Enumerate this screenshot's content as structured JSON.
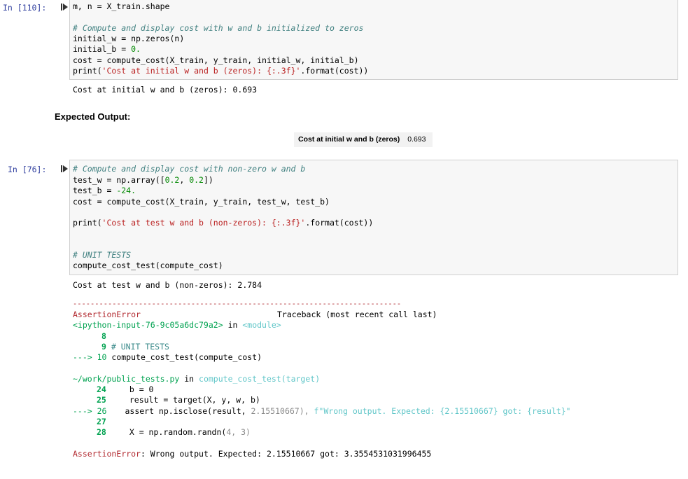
{
  "cell110": {
    "prompt": "In [110]:",
    "code": {
      "line0": "m, n = X_train.shape",
      "comment": "# Compute and display cost with w and b initialized to zeros",
      "l_iw": "initial_w = np.zeros(n)",
      "l_ib_a": "initial_b = ",
      "l_ib_b": "0.",
      "l_cost": "cost = compute_cost(X_train, y_train, initial_w, initial_b)",
      "l_print_a": "print(",
      "l_print_s": "'Cost at initial w and b (zeros): {:.3f}'",
      "l_print_b": ".format(cost))"
    },
    "output": "Cost at initial w and b (zeros): 0.693"
  },
  "expected": {
    "heading": "Expected Output:",
    "table_label": "Cost at initial w and b (zeros)",
    "table_value": "0.693"
  },
  "cell76": {
    "prompt": "In [76]:",
    "code": {
      "comment1": "# Compute and display cost with non-zero w and b",
      "l_tw": "test_w = np.array([0.2, 0.2])",
      "l_tb_a": "test_b = ",
      "l_tb_b": "-24.",
      "l_cost": "cost = compute_cost(X_train, y_train, test_w, test_b)",
      "l_print_a": "print(",
      "l_print_s": "'Cost at test w and b (non-zeros): {:.3f}'",
      "l_print_b": ".format(cost))",
      "comment2": "# UNIT TESTS",
      "l_test": "compute_cost_test(compute_cost)"
    },
    "output": "Cost at test w and b (non-zeros): 2.784",
    "traceback": {
      "dashes": "---------------------------------------------------------------------------",
      "err_name": "AssertionError",
      "tb_label": "Traceback (most recent call last)",
      "input_ref": "<ipython-input-76-9c05a6dc79a2>",
      "in_word": " in ",
      "module": "<module>",
      "ln8": "8",
      "ln9": "9",
      "ln9_code": "# UNIT TESTS",
      "arrow10": "---> 10",
      "ln10_code": "compute_cost_test(compute_cost)",
      "file": "~/work/public_tests.py",
      "in_word2": " in ",
      "func": "compute_cost_test(target)",
      "ln24": "24",
      "ln24_code": "b = 0",
      "ln25": "25",
      "ln25_code": "result = target(X, y, w, b)",
      "arrow26": "---> 26",
      "ln26_a": "assert np.isclose(result, ",
      "ln26_b": "2.15510667), ",
      "ln26_c": "f\"Wrong output. Expected: {2.15510667} got: {result}\"",
      "ln27": "27",
      "ln28": "28",
      "ln28_a": "X = np.random.randn(",
      "ln28_b": "4, 3)",
      "final_err": "AssertionError",
      "final_msg": ": Wrong output. Expected: 2.15510667 got: 3.3554531031996455"
    }
  }
}
